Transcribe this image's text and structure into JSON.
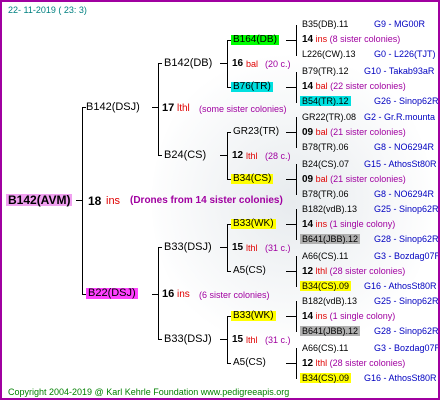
{
  "header": "22- 11-2019 ( 23: 3)",
  "footer": "Copyright 2004-2019 @ Karl Kehrle Foundation    www.pedigreeapis.org",
  "root": {
    "name": "B142(AVM)",
    "num": "18",
    "label": "ins",
    "note": "(Drones from 14 sister colonies)"
  },
  "g1": [
    {
      "name": "B142(DSJ)",
      "num": "17",
      "label": "lthl",
      "note": "(some sister colonies)"
    },
    {
      "name": "B22(DSJ)",
      "num": "16",
      "label": "ins",
      "note": "(6 sister colonies)"
    }
  ],
  "g2": [
    {
      "name": "B142(DB)",
      "num": "16",
      "label": "bal",
      "note": "(20 c.)"
    },
    {
      "name": "B24(CS)",
      "num": "12",
      "label": "lthl",
      "note": "(28 c.)"
    },
    {
      "name": "B33(DSJ)",
      "num": "15",
      "label": "lthl",
      "note": "(31 c.)"
    },
    {
      "name": "B33(DSJ)",
      "num": "15",
      "label": "lthl",
      "note": "(31 c.)"
    }
  ],
  "g3": [
    {
      "name": "B164(DB)"
    },
    {
      "name": "B76(TR)"
    },
    {
      "name": "GR23(TR)"
    },
    {
      "name": "B34(CS)"
    },
    {
      "name": "B33(WK)"
    },
    {
      "name": "A5(CS)"
    },
    {
      "name": "B33(WK)"
    },
    {
      "name": "A5(CS)"
    }
  ],
  "g4": [
    {
      "name": "B35(DB).11",
      "code": "G9 - MG00R"
    },
    {
      "num": "14",
      "label": "ins",
      "note": "(8 sister colonies)"
    },
    {
      "name": "L226(CW).13",
      "code": "G0 - L226(TJT)"
    },
    {
      "name": "B79(TR).12",
      "code": "G10 - Takab93aR"
    },
    {
      "num": "14",
      "label": "bal",
      "note": "(22 sister colonies)"
    },
    {
      "name": "B54(TR).12",
      "code": "G26 - Sinop62R"
    },
    {
      "name": "GR22(TR).08",
      "code": "G2 - Gr.R.mounta"
    },
    {
      "num": "09",
      "label": "bal",
      "note": "(21 sister colonies)"
    },
    {
      "name": "B78(TR).06",
      "code": "G8 - NO6294R"
    },
    {
      "name": "B24(CS).07",
      "code": "G15 - AthosSt80R"
    },
    {
      "num": "09",
      "label": "bal",
      "note": "(21 sister colonies)"
    },
    {
      "name": "B78(TR).06",
      "code": "G8 - NO6294R"
    },
    {
      "name": "B182(vdB).13",
      "code": "G25 - Sinop62R"
    },
    {
      "num": "14",
      "label": "ins",
      "note": "(1 single colony)"
    },
    {
      "name": "B641(JBB).12",
      "code": "G28 - Sinop62R"
    },
    {
      "name": "A66(CS).11",
      "code": "G3 - Bozdag07R"
    },
    {
      "num": "12",
      "label": "lthl",
      "note": "(28 sister colonies)"
    },
    {
      "name": "B34(CS).09",
      "code": "G16 - AthosSt80R"
    },
    {
      "name": "B182(vdB).13",
      "code": "G25 - Sinop62R"
    },
    {
      "num": "14",
      "label": "ins",
      "note": "(1 single colony)"
    },
    {
      "name": "B641(JBB).12",
      "code": "G28 - Sinop62R"
    },
    {
      "name": "A66(CS).11",
      "code": "G3 - Bozdag07R"
    },
    {
      "num": "12",
      "label": "lthl",
      "note": "(28 sister colonies)"
    },
    {
      "name": "B34(CS).09",
      "code": "G16 - AthosSt80R"
    }
  ]
}
